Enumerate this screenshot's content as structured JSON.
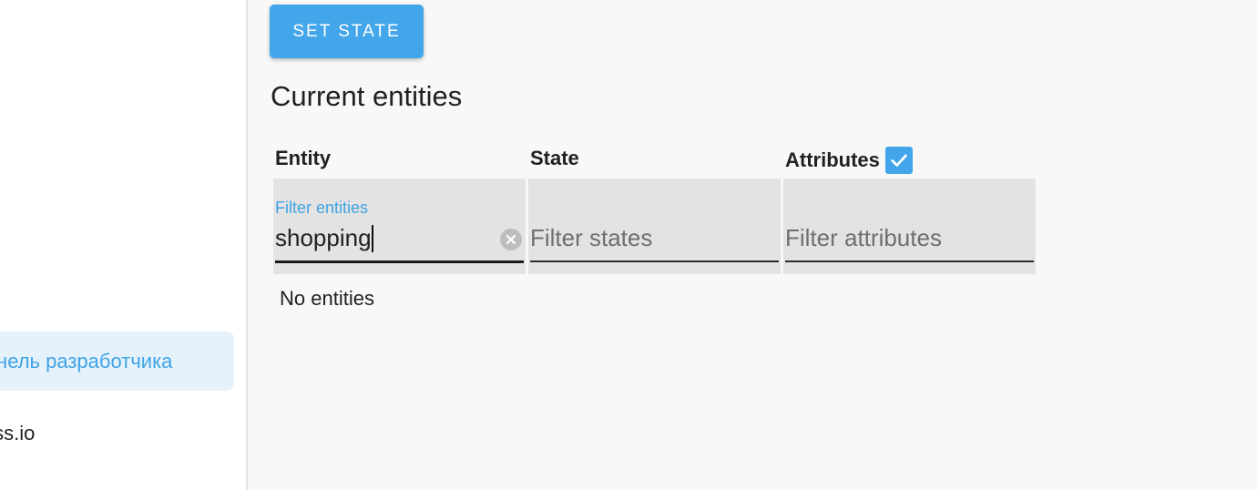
{
  "sidebar": {
    "items": [
      {
        "label": "Панель разработчика",
        "active": true
      },
      {
        "label": "Hass.io",
        "active": false
      }
    ]
  },
  "main": {
    "set_state_label": "SET STATE",
    "section_title": "Current entities",
    "columns": {
      "entity": "Entity",
      "state": "State",
      "attributes": "Attributes"
    },
    "attributes_checkbox_checked": true,
    "filters": {
      "entity_label": "Filter entities",
      "entity_value": "shopping",
      "state_placeholder": "Filter states",
      "attributes_placeholder": "Filter attributes"
    },
    "empty_text": "No entities"
  },
  "colors": {
    "accent": "#44a6ea",
    "active_bg": "#e6f2fb",
    "filter_bg": "#e3e3e3"
  },
  "icons": {
    "checkbox": "check-icon",
    "clear": "clear-icon"
  }
}
